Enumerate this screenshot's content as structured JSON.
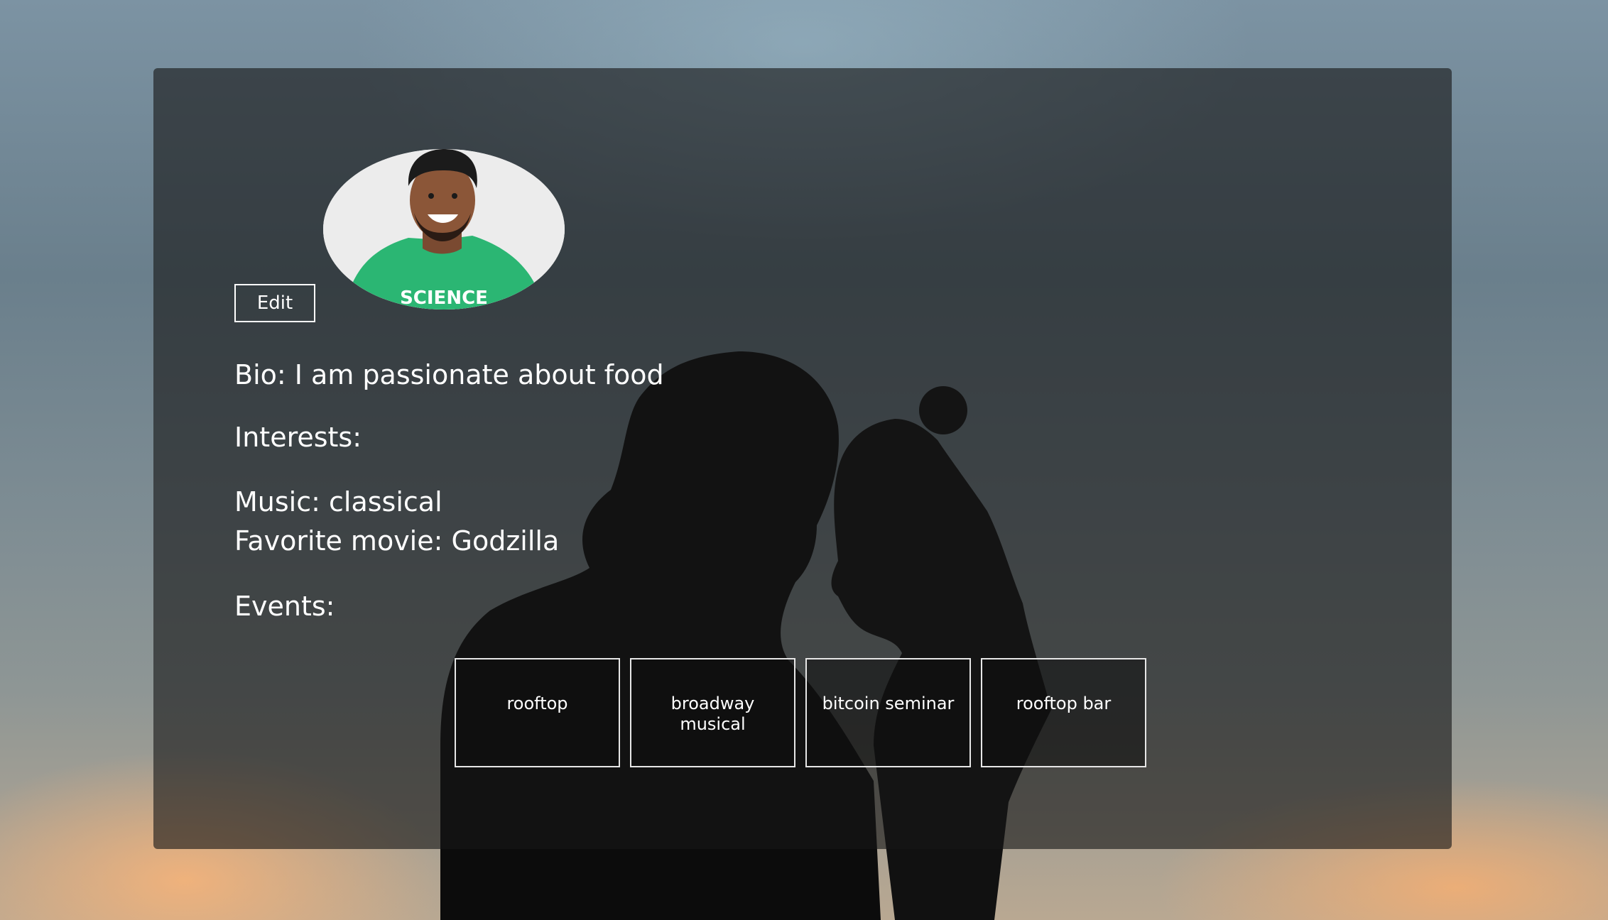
{
  "profile": {
    "edit_label": "Edit",
    "bio": "Bio: I am passionate about food",
    "interests_heading": "Interests:",
    "music": "Music: classical",
    "favorite_movie": "Favorite movie: Godzilla",
    "events_heading": "Events:",
    "avatar_shirt_text": "SCIENCE"
  },
  "events": [
    {
      "label": "rooftop"
    },
    {
      "label": "broadway musical"
    },
    {
      "label": "bitcoin seminar"
    },
    {
      "label": "rooftop bar"
    }
  ],
  "colors": {
    "panel": "#161616",
    "text": "#ffffff",
    "shirt": "#2bb673"
  }
}
